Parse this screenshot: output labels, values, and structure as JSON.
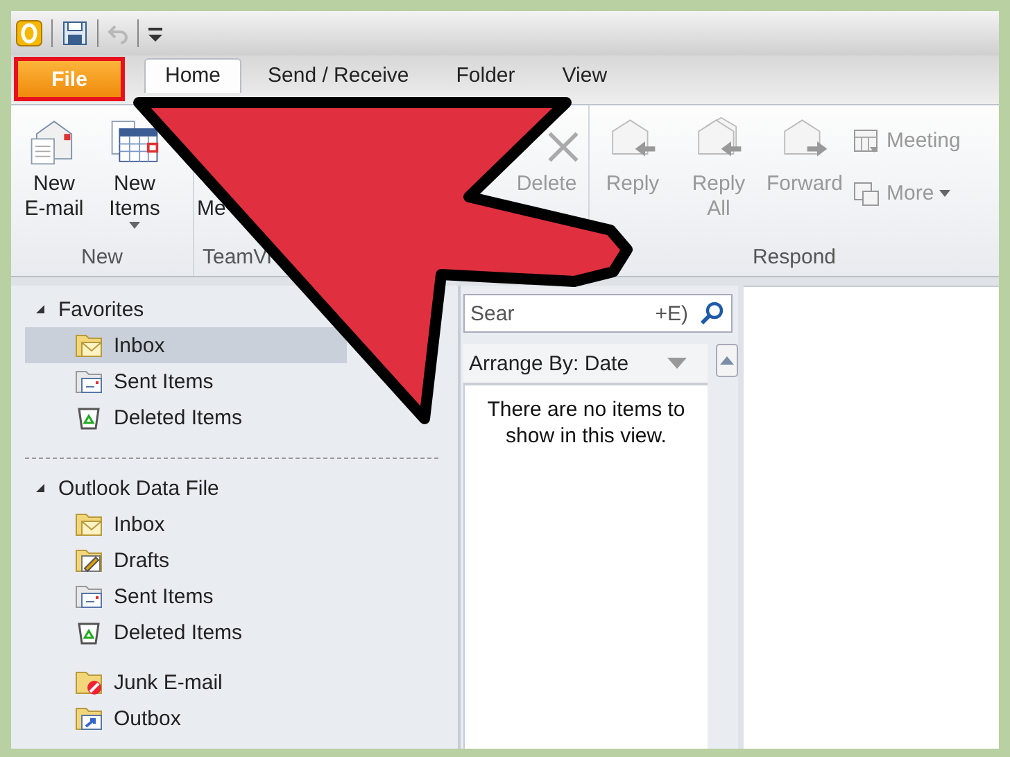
{
  "quick_access": {
    "items": [
      {
        "kind": "outlook"
      },
      {
        "kind": "save"
      },
      {
        "kind": "undo"
      },
      {
        "kind": "customize"
      }
    ]
  },
  "tabs": [
    {
      "label": "File",
      "kind": "file",
      "selected": false,
      "highlighted": true
    },
    {
      "label": "Home",
      "kind": "tab",
      "selected": true,
      "highlighted": false
    },
    {
      "label": "Send / Receive",
      "kind": "tab",
      "selected": false,
      "highlighted": false
    },
    {
      "label": "Folder",
      "kind": "tab",
      "selected": false,
      "highlighted": false
    },
    {
      "label": "View",
      "kind": "tab",
      "selected": false,
      "highlighted": false
    }
  ],
  "ribbon": {
    "groups": [
      {
        "label": "New",
        "buttons": [
          {
            "label": "New E-mail",
            "kind": "mail",
            "disabled": false,
            "dropdown": false
          },
          {
            "label": "New Items",
            "kind": "calendar",
            "disabled": false,
            "dropdown": true
          }
        ]
      },
      {
        "label": "TeamVi",
        "buttons": [
          {
            "label": "Me",
            "kind": "text",
            "disabled": false,
            "dropdown": false
          }
        ]
      },
      {
        "buttons": [
          {
            "label": "Delete",
            "kind": "delete",
            "disabled": true,
            "dropdown": false
          }
        ]
      },
      {
        "label": "Respond",
        "buttons": [
          {
            "label": "Reply",
            "kind": "reply",
            "disabled": true,
            "dropdown": false
          },
          {
            "label": "Reply All",
            "kind": "replyall",
            "disabled": true,
            "dropdown": false
          },
          {
            "label": "Forward",
            "kind": "forward",
            "disabled": true,
            "dropdown": false
          },
          {
            "label": "Meeting",
            "kind": "meeting",
            "disabled": true,
            "dropdown": false
          },
          {
            "label": "More",
            "kind": "more",
            "disabled": true,
            "dropdown": true
          }
        ]
      }
    ]
  },
  "navigation": {
    "sections": [
      {
        "label": "Favorites",
        "expanded": true,
        "item_groups": [
          {
            "items": [
              {
                "label": "Inbox",
                "kind": "inbox",
                "selected": true
              },
              {
                "label": "Sent Items",
                "kind": "sent",
                "selected": false
              },
              {
                "label": "Deleted Items",
                "kind": "deleted",
                "selected": false
              }
            ]
          }
        ]
      },
      {
        "label": "Outlook Data File",
        "expanded": true,
        "item_groups": [
          {
            "items": [
              {
                "label": "Inbox",
                "kind": "inbox",
                "selected": false
              },
              {
                "label": "Drafts",
                "kind": "drafts",
                "selected": false
              },
              {
                "label": "Sent Items",
                "kind": "sent",
                "selected": false
              },
              {
                "label": "Deleted Items",
                "kind": "deleted",
                "selected": false
              }
            ]
          },
          {
            "items": [
              {
                "label": "Junk E-mail",
                "kind": "junk",
                "selected": false
              },
              {
                "label": "Outbox",
                "kind": "outbox",
                "selected": false
              }
            ]
          }
        ]
      }
    ]
  },
  "message_list": {
    "search": {
      "placeholder": "Sear",
      "placeholder_end": "+E)"
    },
    "arrange_by": "Arrange By: Date",
    "empty_message": "There are no items to show in this view."
  },
  "annotations": [
    {
      "kind": "arrow"
    }
  ]
}
